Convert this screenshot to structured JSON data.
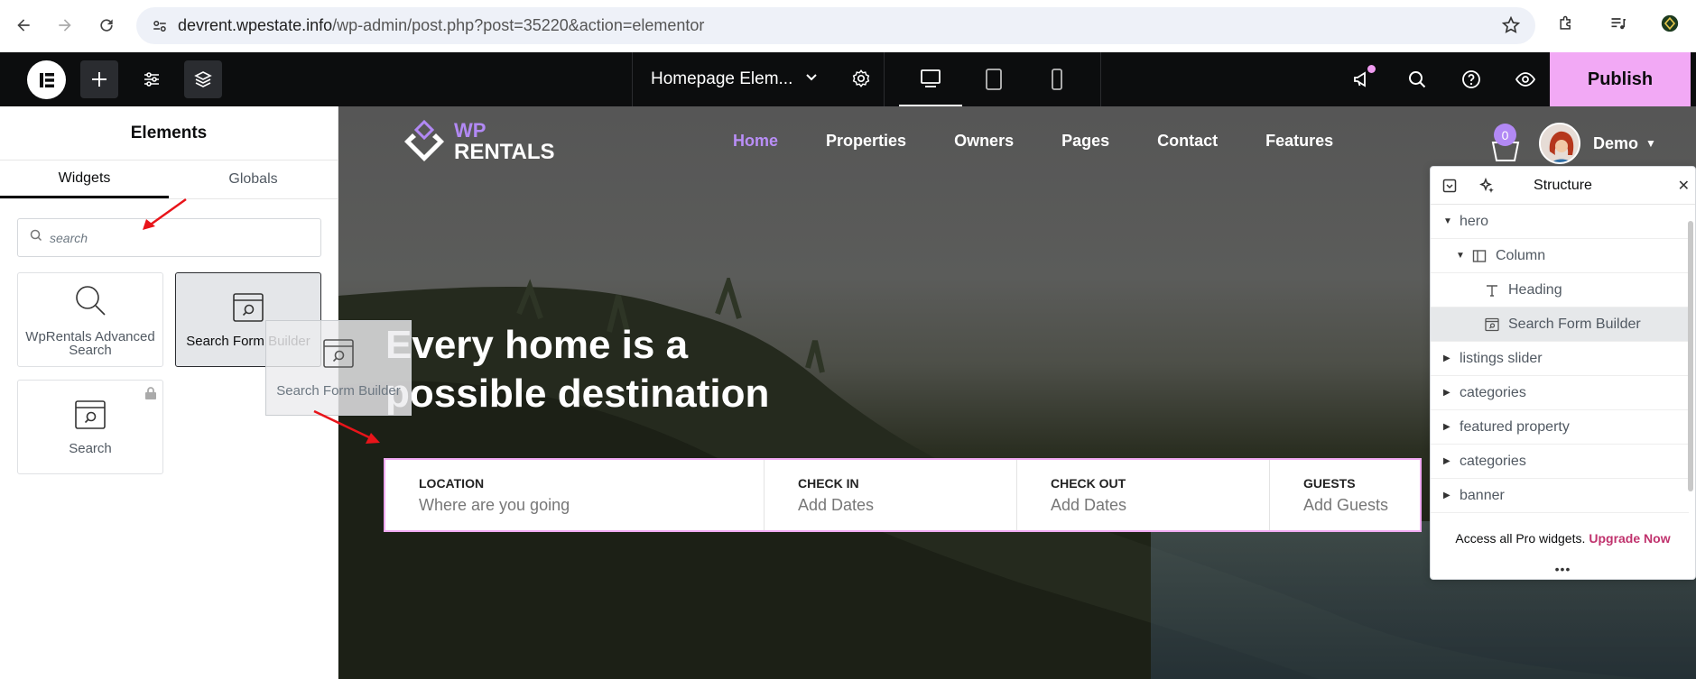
{
  "browser": {
    "url_host": "devrent.wpestate.info",
    "url_path": "/wp-admin/post.php?post=35220&action=elementor"
  },
  "topbar": {
    "document_title": "Homepage Elem...",
    "publish_label": "Publish"
  },
  "panel": {
    "title": "Elements",
    "tabs": [
      "Widgets",
      "Globals"
    ],
    "search_placeholder": "search",
    "widgets": [
      {
        "label": "WpRentals Advanced Search"
      },
      {
        "label": "Search Form Builder"
      },
      {
        "label": "Search"
      }
    ],
    "drag_ghost_label": "Search Form Builder"
  },
  "site": {
    "logo_top": "WP",
    "logo_bottom": "RENTALS",
    "nav": [
      "Home",
      "Properties",
      "Owners",
      "Pages",
      "Contact",
      "Features"
    ],
    "cart_count": "0",
    "user_name": "Demo",
    "hero_title_line1": "Every home is a",
    "hero_title_line2": "possible destination",
    "search_fields": [
      {
        "label": "LOCATION",
        "placeholder": "Where are you going"
      },
      {
        "label": "CHECK IN",
        "placeholder": "Add Dates"
      },
      {
        "label": "CHECK OUT",
        "placeholder": "Add Dates"
      },
      {
        "label": "GUESTS",
        "placeholder": "Add Guests"
      }
    ]
  },
  "structure": {
    "title": "Structure",
    "items": [
      {
        "label": "hero"
      },
      {
        "label": "Column"
      },
      {
        "label": "Heading"
      },
      {
        "label": "Search Form Builder"
      },
      {
        "label": "listings slider"
      },
      {
        "label": "categories"
      },
      {
        "label": "featured property"
      },
      {
        "label": "categories"
      },
      {
        "label": "banner"
      }
    ],
    "promo_text": "Access all Pro widgets.",
    "promo_link": "Upgrade Now"
  },
  "colors": {
    "accent_pink": "#f2a9f5",
    "brand_purple": "#b289f5",
    "annotation_red": "#e8141a"
  }
}
